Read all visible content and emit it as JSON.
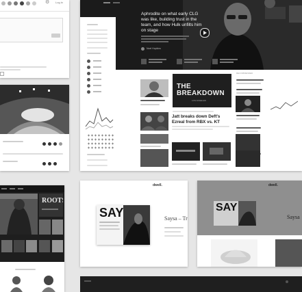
{
  "login_card": {
    "link": "Log in"
  },
  "article_card": {
    "hero_title": "Aphrodite on what early CLG was like, building trust in the team, and how Hulk unfilts him on stage",
    "author": "Noel Hopkins",
    "breakdown_title": "THE BREAKDOWN",
    "breakdown_sub": "LOS ANGELES",
    "headline": "Jatt breaks down Deft's Ezreal from RBX vs. KT",
    "sidebar_label": "RECOMMENDED"
  },
  "dark_card": {
    "headline": "ROOTS"
  },
  "magazine_card": {
    "brand": "dwell.",
    "say": "SAY",
    "title": "Saysa – Tr"
  },
  "magazine_card_2": {
    "brand": "dwell.",
    "say": "SAY",
    "title": "Saysa"
  },
  "colors": {
    "background": "#e6e6e6",
    "dark": "#1b1b1b",
    "card": "#ffffff"
  }
}
